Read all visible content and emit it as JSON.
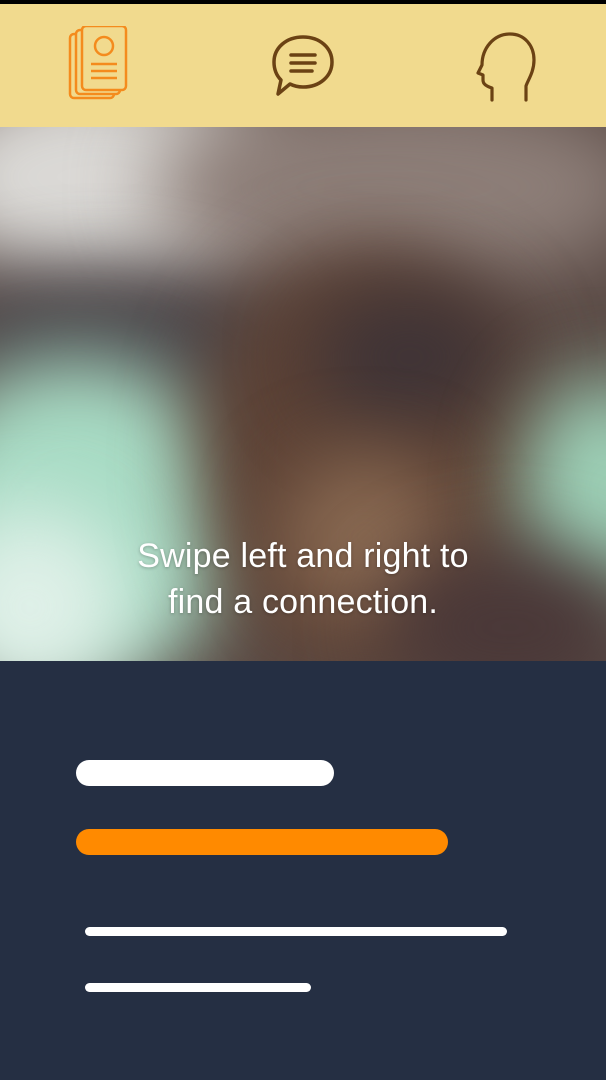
{
  "nav": {
    "items": [
      {
        "icon": "profile-cards-icon",
        "active": true,
        "color": "#f48b1d"
      },
      {
        "icon": "chat-bubble-icon",
        "active": false,
        "color": "#6b4214"
      },
      {
        "icon": "head-silhouette-icon",
        "active": false,
        "color": "#6b4214"
      }
    ],
    "background": "#f1da8e"
  },
  "photo": {
    "caption_line1": "Swipe left and right to",
    "caption_line2": "find a connection."
  },
  "placeholders": {
    "background": "#252f43",
    "white": "#ffffff",
    "accent": "#ff8a00"
  }
}
